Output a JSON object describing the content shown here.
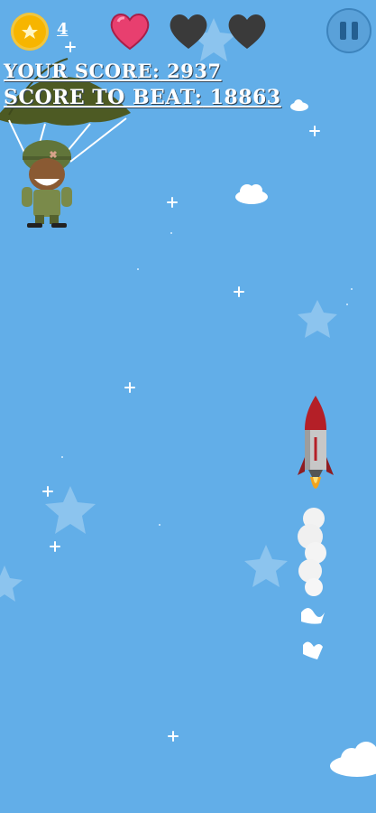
{
  "hud": {
    "coins": "4",
    "score_label": "YOUR SCORE:",
    "score_value": "2937",
    "beat_label": "SCORE TO BEAT:",
    "beat_value": "18863"
  },
  "lives": {
    "total": 3,
    "remaining": 1
  },
  "colors": {
    "sky": "#62aee8",
    "heart_full": "#e83f6f",
    "heart_empty": "#3a3a3a",
    "coin": "#f7b500"
  },
  "icons": [
    "coin-icon",
    "heart-icon",
    "pause-icon",
    "rocket-icon",
    "parachute-soldier-icon",
    "cloud-icon",
    "star-icon"
  ]
}
